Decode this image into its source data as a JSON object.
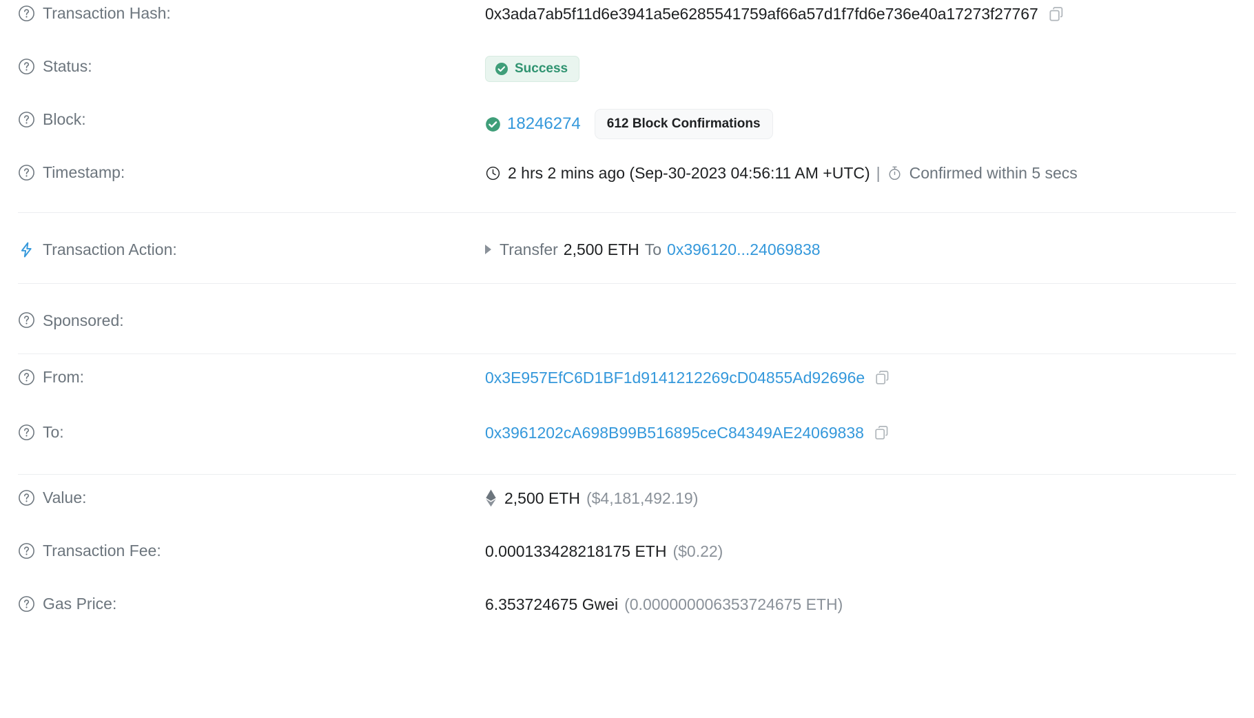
{
  "transaction": {
    "hash": {
      "label": "Transaction Hash:",
      "value": "0x3ada7ab5f11d6e3941a5e6285541759af66a57d1f7fd6e736e40a17273f27767",
      "copy_icon": "copy-icon",
      "help_icon": "question-circle-icon"
    },
    "status": {
      "label": "Status:",
      "value": "Success",
      "badge_bg": "#e9f5ef",
      "badge_color": "#2f9370",
      "check_icon": "check-circle-icon",
      "help_icon": "question-circle-icon"
    },
    "block": {
      "label": "Block:",
      "number": "18246274",
      "confirmations": "612 Block Confirmations",
      "check_icon": "check-circle-icon",
      "help_icon": "question-circle-icon",
      "link_color": "#3498db"
    },
    "timestamp": {
      "label": "Timestamp:",
      "relative": "2 hrs 2 mins ago (Sep-30-2023 04:56:11 AM +UTC)",
      "separator": "|",
      "confirmed": "Confirmed within 5 secs",
      "clock_icon": "clock-icon",
      "stopwatch_icon": "stopwatch-icon",
      "help_icon": "question-circle-icon"
    },
    "action": {
      "label": "Transaction Action:",
      "verb": "Transfer",
      "amount": "2,500 ETH",
      "preposition": "To",
      "target": "0x396120...24069838",
      "bolt_icon": "lightning-bolt-icon",
      "caret_icon": "caret-right-icon",
      "bolt_color": "#3498db"
    },
    "sponsored": {
      "label": "Sponsored:",
      "value": "",
      "help_icon": "question-circle-icon"
    },
    "from": {
      "label": "From:",
      "address": "0x3E957EfC6D1BF1d9141212269cD04855Ad92696e",
      "copy_icon": "copy-icon",
      "help_icon": "question-circle-icon"
    },
    "to": {
      "label": "To:",
      "address": "0x3961202cA698B99B516895ceC84349AE24069838",
      "copy_icon": "copy-icon",
      "help_icon": "question-circle-icon"
    },
    "value": {
      "label": "Value:",
      "eth": "2,500 ETH",
      "fiat": "($4,181,492.19)",
      "eth_icon": "ethereum-diamond-icon",
      "help_icon": "question-circle-icon"
    },
    "fee": {
      "label": "Transaction Fee:",
      "eth": "0.000133428218175 ETH",
      "fiat": "($0.22)",
      "help_icon": "question-circle-icon"
    },
    "gas_price": {
      "label": "Gas Price:",
      "gwei": "6.353724675 Gwei",
      "eth": "(0.000000006353724675 ETH)",
      "help_icon": "question-circle-icon"
    }
  }
}
